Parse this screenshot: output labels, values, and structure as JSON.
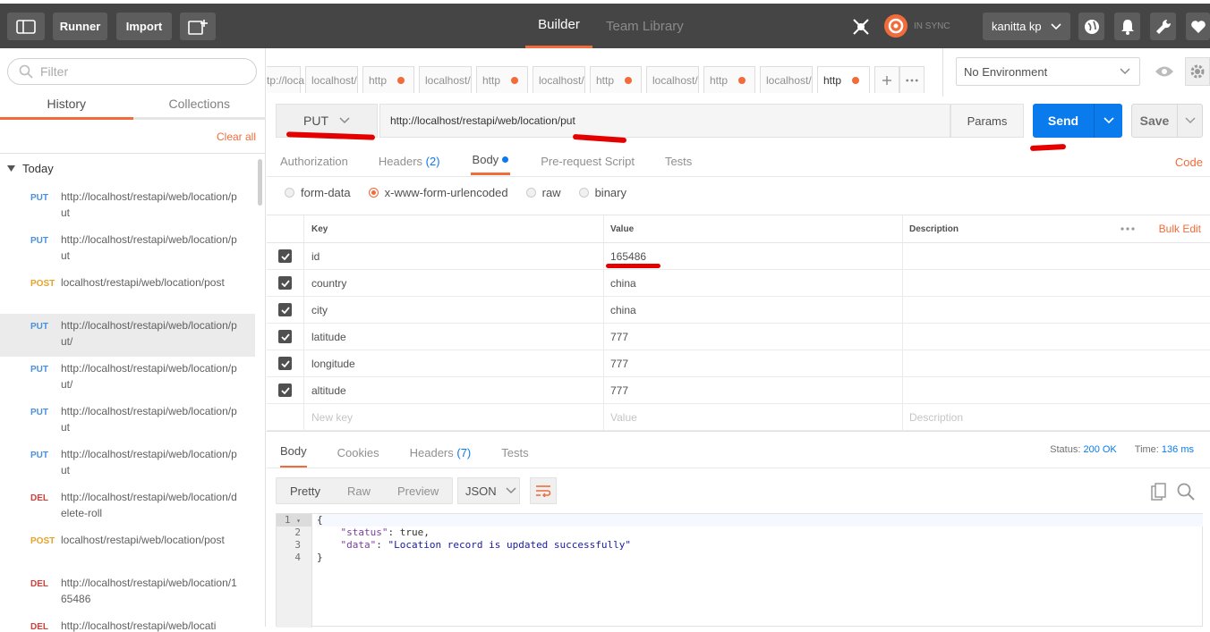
{
  "topbar": {
    "runner": "Runner",
    "import": "Import",
    "builder": "Builder",
    "team_library": "Team Library",
    "sync": "IN SYNC",
    "user": "kanitta kp"
  },
  "sidebar": {
    "filter_placeholder": "Filter",
    "tabs": [
      "History",
      "Collections"
    ],
    "clear_all": "Clear all",
    "group": "Today",
    "items": [
      {
        "method": "PUT",
        "url": "http://localhost/restapi/web/location/put"
      },
      {
        "method": "PUT",
        "url": "http://localhost/restapi/web/location/put"
      },
      {
        "method": "POST",
        "url": "localhost/restapi/web/location/post"
      },
      {
        "method": "PUT",
        "url": "http://localhost/restapi/web/location/put/"
      },
      {
        "method": "PUT",
        "url": "http://localhost/restapi/web/location/put/"
      },
      {
        "method": "PUT",
        "url": "http://localhost/restapi/web/location/put"
      },
      {
        "method": "PUT",
        "url": "http://localhost/restapi/web/location/put"
      },
      {
        "method": "DEL",
        "url": "http://localhost/restapi/web/location/delete-roll"
      },
      {
        "method": "POST",
        "url": "localhost/restapi/web/location/post"
      },
      {
        "method": "DEL",
        "url": "http://localhost/restapi/web/location/165486"
      },
      {
        "method": "DEL",
        "url": "http://localhost/restapi/web/locati"
      }
    ]
  },
  "request_tabs": [
    "tp://loca",
    "localhost/",
    "http",
    "localhost/",
    "http",
    "localhost/",
    "http",
    "localhost/",
    "http",
    "localhost/",
    "http"
  ],
  "environment": "No Environment",
  "request": {
    "method": "PUT",
    "url": "http://localhost/restapi/web/location/put",
    "params": "Params",
    "send": "Send",
    "save": "Save"
  },
  "req_tabs": {
    "authorization": "Authorization",
    "headers": "Headers",
    "headers_count": "(2)",
    "body": "Body",
    "prerequest": "Pre-request Script",
    "tests": "Tests",
    "code": "Code"
  },
  "body_types": [
    "form-data",
    "x-www-form-urlencoded",
    "raw",
    "binary"
  ],
  "kv": {
    "headers": {
      "key": "Key",
      "value": "Value",
      "description": "Description",
      "bulk_edit": "Bulk Edit"
    },
    "rows": [
      {
        "key": "id",
        "value": "165486"
      },
      {
        "key": "country",
        "value": "china"
      },
      {
        "key": "city",
        "value": "china"
      },
      {
        "key": "latitude",
        "value": "777"
      },
      {
        "key": "longitude",
        "value": "777"
      },
      {
        "key": "altitude",
        "value": "777"
      }
    ],
    "placeholders": {
      "key": "New key",
      "value": "Value",
      "description": "Description"
    }
  },
  "response": {
    "tabs": {
      "body": "Body",
      "cookies": "Cookies",
      "headers": "Headers",
      "headers_count": "(7)",
      "tests": "Tests"
    },
    "status_label": "Status:",
    "status_value": "200 OK",
    "time_label": "Time:",
    "time_value": "136 ms",
    "formats": [
      "Pretty",
      "Raw",
      "Preview"
    ],
    "lang": "JSON",
    "lines": [
      "1",
      "2",
      "3",
      "4"
    ],
    "code": {
      "open": "{",
      "status_key": "\"status\"",
      "status_val": "true",
      "data_key": "\"data\"",
      "data_val": "\"Location record is updated successfully\"",
      "close": "}"
    }
  },
  "colors": {
    "accent": "#f26b3a",
    "send": "#097bed",
    "topbar": "#454545",
    "annotation": "#e40000"
  }
}
